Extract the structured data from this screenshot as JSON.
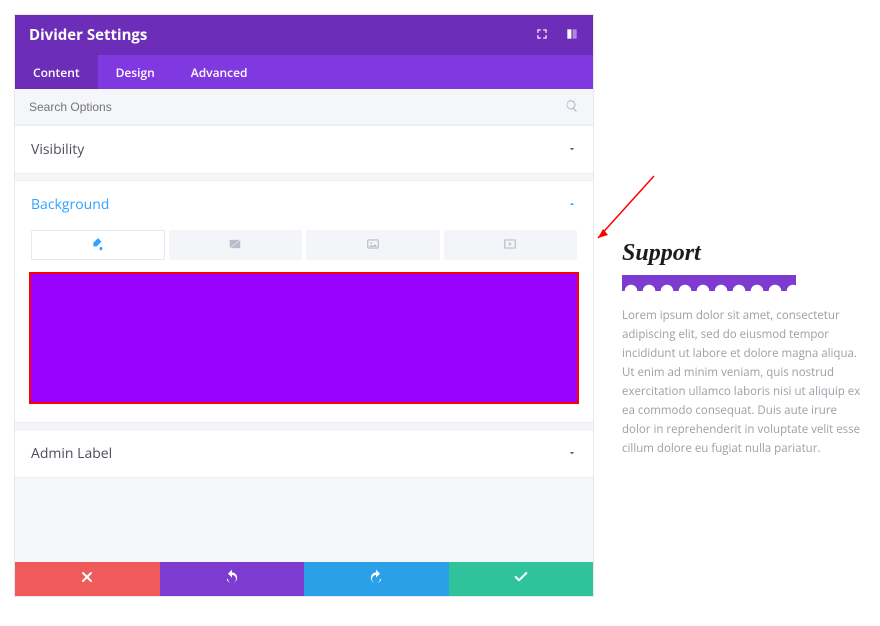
{
  "titlebar": {
    "title": "Divider Settings"
  },
  "tabs": {
    "content": "Content",
    "design": "Design",
    "advanced": "Advanced"
  },
  "search": {
    "placeholder": "Search Options"
  },
  "sections": {
    "visibility": "Visibility",
    "background": "Background",
    "admin_label": "Admin Label"
  },
  "colors": {
    "swatch": "#9900ff",
    "swatch_outline": "#ff0000",
    "accent_purple": "#7e3bd0"
  },
  "preview": {
    "heading": "Support",
    "body": "Lorem ipsum dolor sit amet, consectetur adipiscing elit, sed do eiusmod tempor incididunt ut labore et dolore magna aliqua. Ut enim ad minim veniam, quis nostrud exercitation ullamco laboris nisi ut aliquip ex ea commodo consequat. Duis aute irure dolor in reprehenderit in voluptate velit esse cillum dolore eu fugiat nulla pariatur."
  }
}
